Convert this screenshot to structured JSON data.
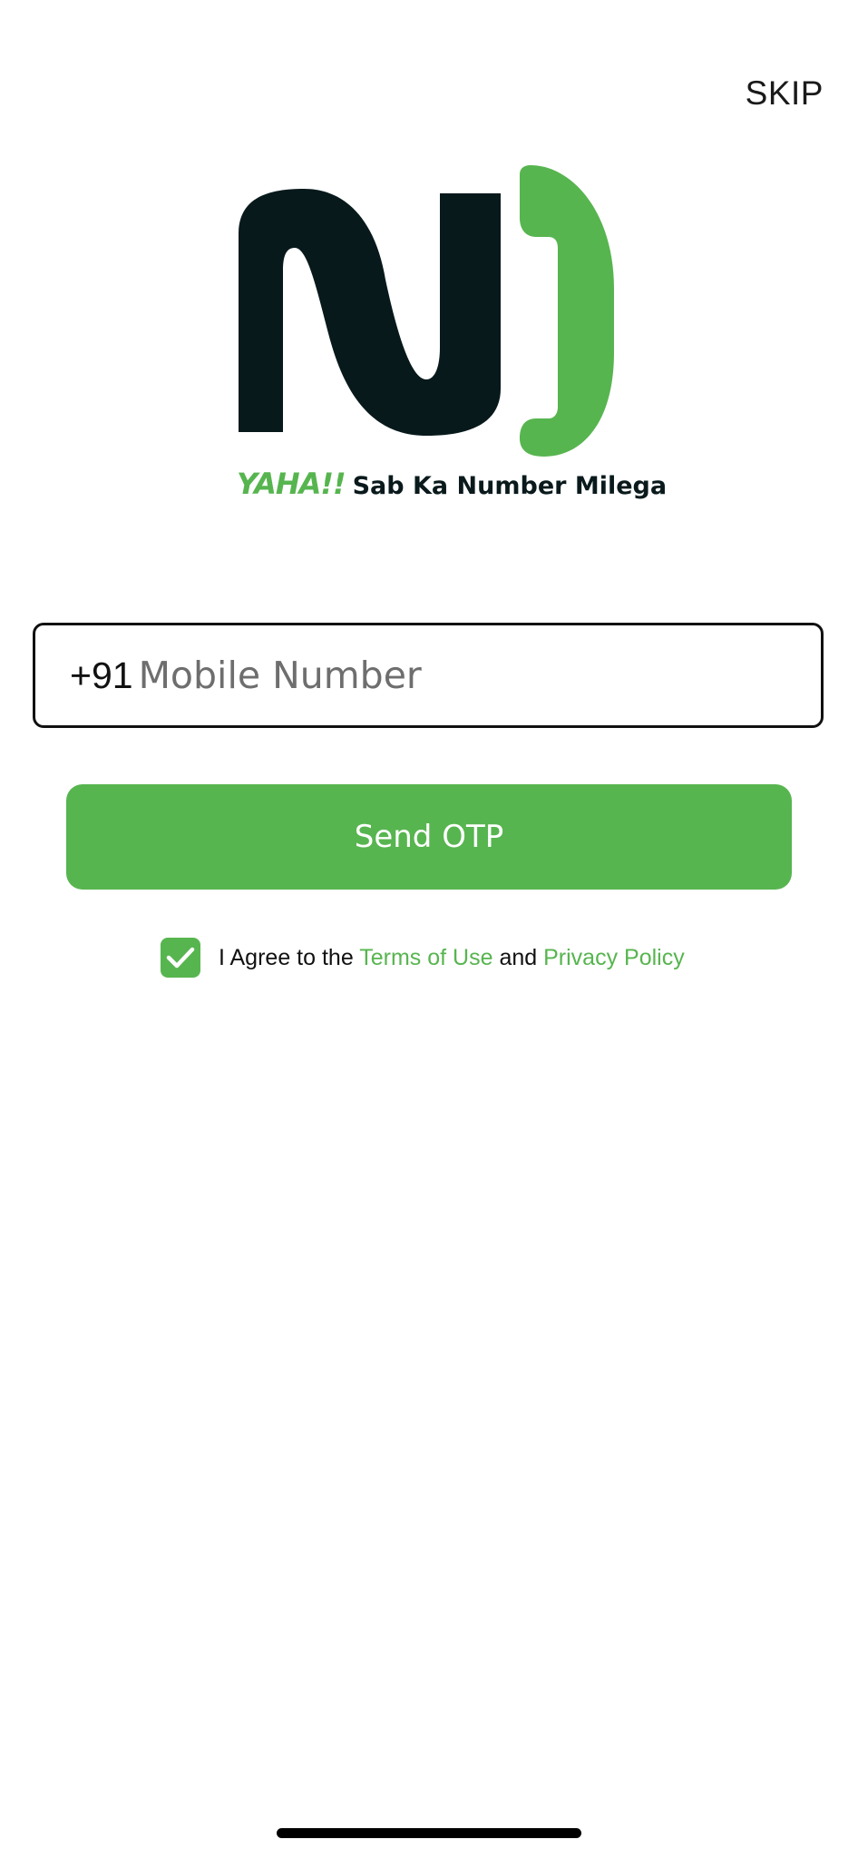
{
  "header": {
    "skip_label": "SKIP"
  },
  "logo": {
    "accent_text": "YAHA!!",
    "tagline": "Sab Ka Number Milega",
    "brand_dark_color": "#08191c",
    "brand_green_color": "#57b54f"
  },
  "login_form": {
    "country_code": "+91",
    "mobile_value": "",
    "mobile_placeholder": "Mobile Number",
    "send_otp_label": "Send OTP"
  },
  "consent": {
    "checked": true,
    "prefix": "I Agree to the",
    "terms_label": "Terms of Use",
    "connector": "and",
    "privacy_label": "Privacy Policy"
  },
  "icons": {
    "checkbox_icon": "check-icon",
    "logo_icon": "phone-handset-icon"
  }
}
